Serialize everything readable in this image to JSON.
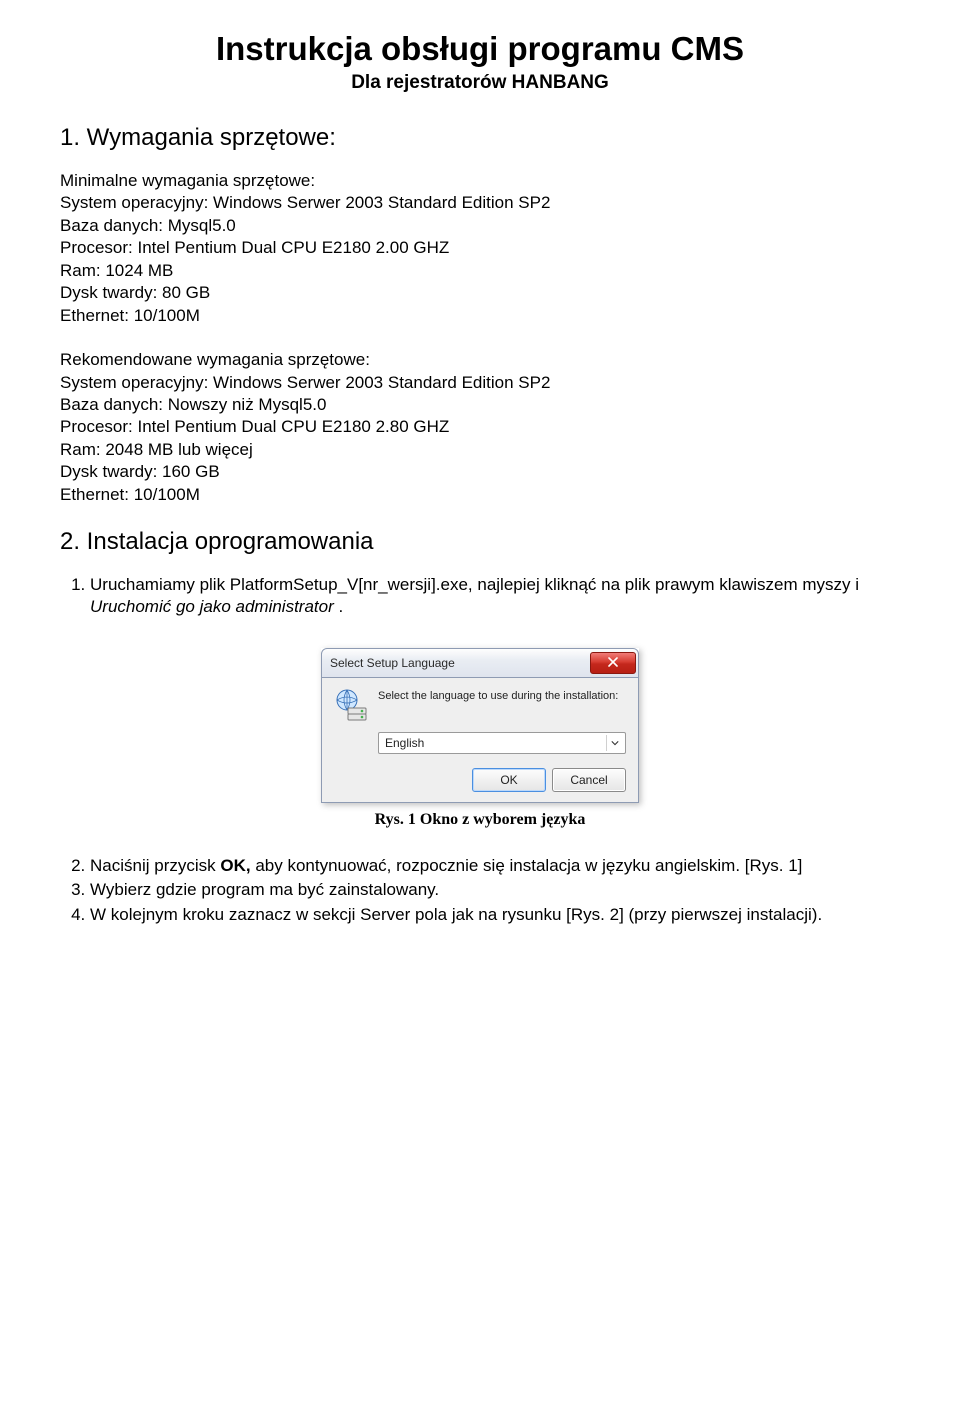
{
  "title": "Instrukcja obsługi programu CMS",
  "subtitle": "Dla rejestratorów HANBANG",
  "section1": {
    "heading": "1. Wymagania sprzętowe:",
    "min_block": "Minimalne wymagania sprzętowe:\nSystem operacyjny: Windows Serwer 2003 Standard Edition SP2\nBaza danych: Mysql5.0\nProcesor: Intel Pentium Dual CPU E2180 2.00 GHZ\nRam: 1024 MB\nDysk twardy: 80 GB\nEthernet: 10/100M",
    "rec_block": "Rekomendowane wymagania sprzętowe:\nSystem operacyjny: Windows Serwer 2003 Standard Edition SP2\nBaza danych: Nowszy niż Mysql5.0\nProcesor: Intel Pentium Dual CPU E2180 2.80 GHZ\nRam: 2048 MB lub więcej\nDysk twardy: 160 GB\nEthernet: 10/100M"
  },
  "section2": {
    "heading": "2. Instalacja oprogramowania",
    "step1_a": "Uruchamiamy plik PlatformSetup_V[nr_wersji].exe, najlepiej kliknąć na plik prawym klawiszem myszy i ",
    "step1_b": "Uruchomić go jako administrator",
    "step1_c": " .",
    "caption": "Rys. 1 Okno z wyborem języka",
    "step2_a": "Naciśnij przycisk ",
    "step2_b": "OK,",
    "step2_c": " aby kontynuować, rozpocznie się instalacja w języku angielskim. [Rys. 1]",
    "step3": "Wybierz gdzie program ma być zainstalowany.",
    "step4": "W kolejnym kroku zaznacz w sekcji Server pola jak na rysunku [Rys. 2] (przy pierwszej instalacji)."
  },
  "dialog": {
    "title": "Select Setup Language",
    "msg": "Select the language to use during the installation:",
    "selected": "English",
    "ok": "OK",
    "cancel": "Cancel"
  }
}
